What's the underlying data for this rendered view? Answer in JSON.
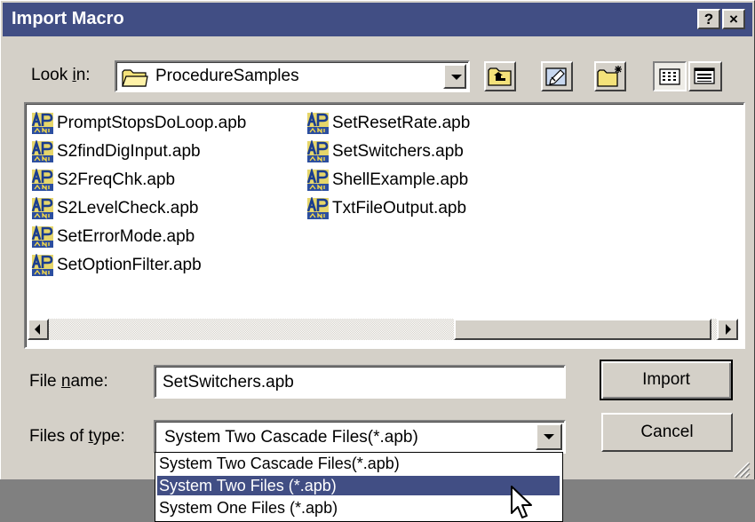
{
  "window": {
    "title": "Import Macro",
    "help_label": "?",
    "close_label": "×"
  },
  "lookin": {
    "label_pre": "Look ",
    "label_u": "i",
    "label_post": "n:",
    "value": "ProcedureSamples"
  },
  "files": [
    {
      "name": "PromptStopsDoLoop.apb"
    },
    {
      "name": "S2findDigInput.apb"
    },
    {
      "name": "S2FreqChk.apb"
    },
    {
      "name": "S2LevelCheck.apb"
    },
    {
      "name": "SetErrorMode.apb"
    },
    {
      "name": "SetOptionFilter.apb"
    },
    {
      "name": "SetResetRate.apb"
    },
    {
      "name": "SetSwitchers.apb"
    },
    {
      "name": "ShellExample.apb"
    },
    {
      "name": "TxtFileOutput.apb"
    }
  ],
  "filename": {
    "label_pre": "File ",
    "label_u": "n",
    "label_post": "ame:",
    "value": "SetSwitchers.apb"
  },
  "filetype": {
    "label_pre": "Files of ",
    "label_u": "t",
    "label_post": "ype:",
    "value": "System Two Cascade Files(*.apb)",
    "options": [
      "System Two Cascade Files(*.apb)",
      "System Two Files (*.apb)",
      "System One Files (*.apb)"
    ],
    "highlighted_index": 1
  },
  "buttons": {
    "import": "Import",
    "cancel": "Cancel"
  },
  "colors": {
    "titlebar": "#414e84",
    "selection": "#414e84",
    "face": "#d4d0c8"
  }
}
